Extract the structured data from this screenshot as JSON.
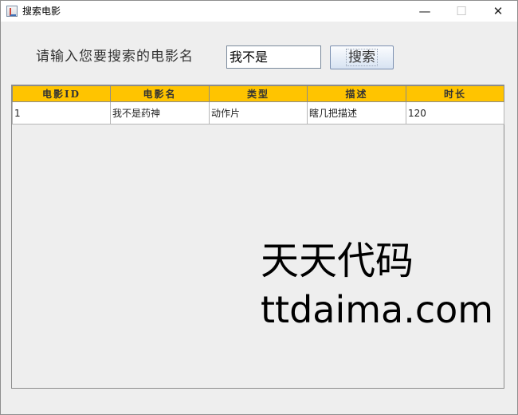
{
  "window": {
    "title": "搜索电影",
    "controls": {
      "minimize": "—",
      "maximize": "☐",
      "close": "✕"
    }
  },
  "search": {
    "label": "请输入您要搜索的电影名",
    "value": "我不是",
    "button_label": "搜索"
  },
  "table": {
    "headers": [
      "电影ID",
      "电影名",
      "类型",
      "描述",
      "时长"
    ],
    "rows": [
      [
        "1",
        "我不是药神",
        "动作片",
        "瞎几把描述",
        "120"
      ]
    ]
  },
  "watermark": {
    "line1": "天天代码",
    "line2": "ttdaima.com"
  },
  "colors": {
    "header_bg": "#ffc400",
    "panel_bg": "#eeeeee"
  },
  "icons": {
    "app": "java-app-icon"
  }
}
